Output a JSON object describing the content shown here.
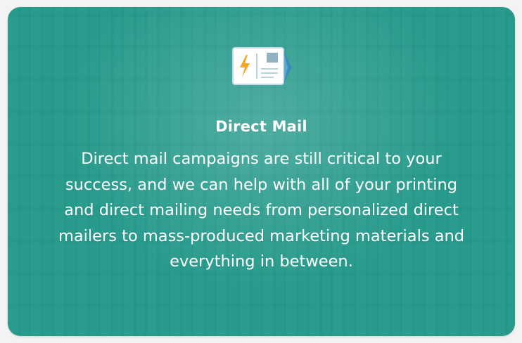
{
  "card": {
    "title": "Direct Mail",
    "description": "Direct mail campaigns are still critical to your success, and we can help with all of your printing and direct mailing needs from personalized direct mailers to mass-produced marketing materials and everything in between.",
    "icon": "postcard-icon"
  },
  "colors": {
    "overlay": "#24998a",
    "text": "#ffffff",
    "accent": "#f5a623",
    "stamp": "#8fb3c4"
  }
}
